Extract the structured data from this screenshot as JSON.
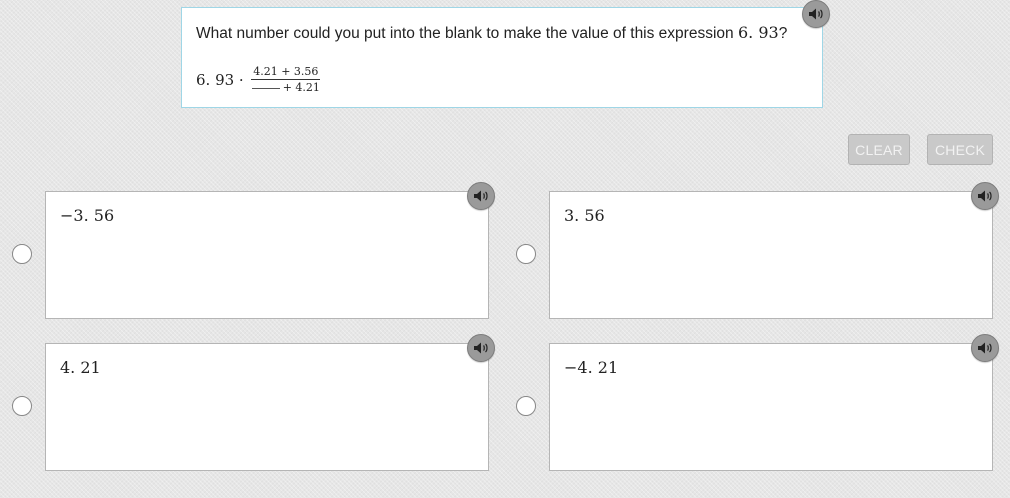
{
  "question": {
    "prompt": "What number could you put into the blank to make the value of this expression",
    "target": "6. 93",
    "suffix": "?",
    "expression": {
      "lead": "6. 93 ·",
      "numerator": "4.21 + 3.56",
      "denominator_rest": "+ 4.21"
    },
    "audio_icon": "speaker-icon"
  },
  "actions": {
    "clear_label": "CLEAR",
    "check_label": "CHECK"
  },
  "options": [
    {
      "text": "−3. 56",
      "selected": false
    },
    {
      "text": "3. 56",
      "selected": false
    },
    {
      "text": "4. 21",
      "selected": false
    },
    {
      "text": "−4. 21",
      "selected": false
    }
  ],
  "colors": {
    "question_border": "#9fd6e6",
    "button_disabled": "#c9c9c9",
    "audio_button": "#9a9a9a"
  }
}
